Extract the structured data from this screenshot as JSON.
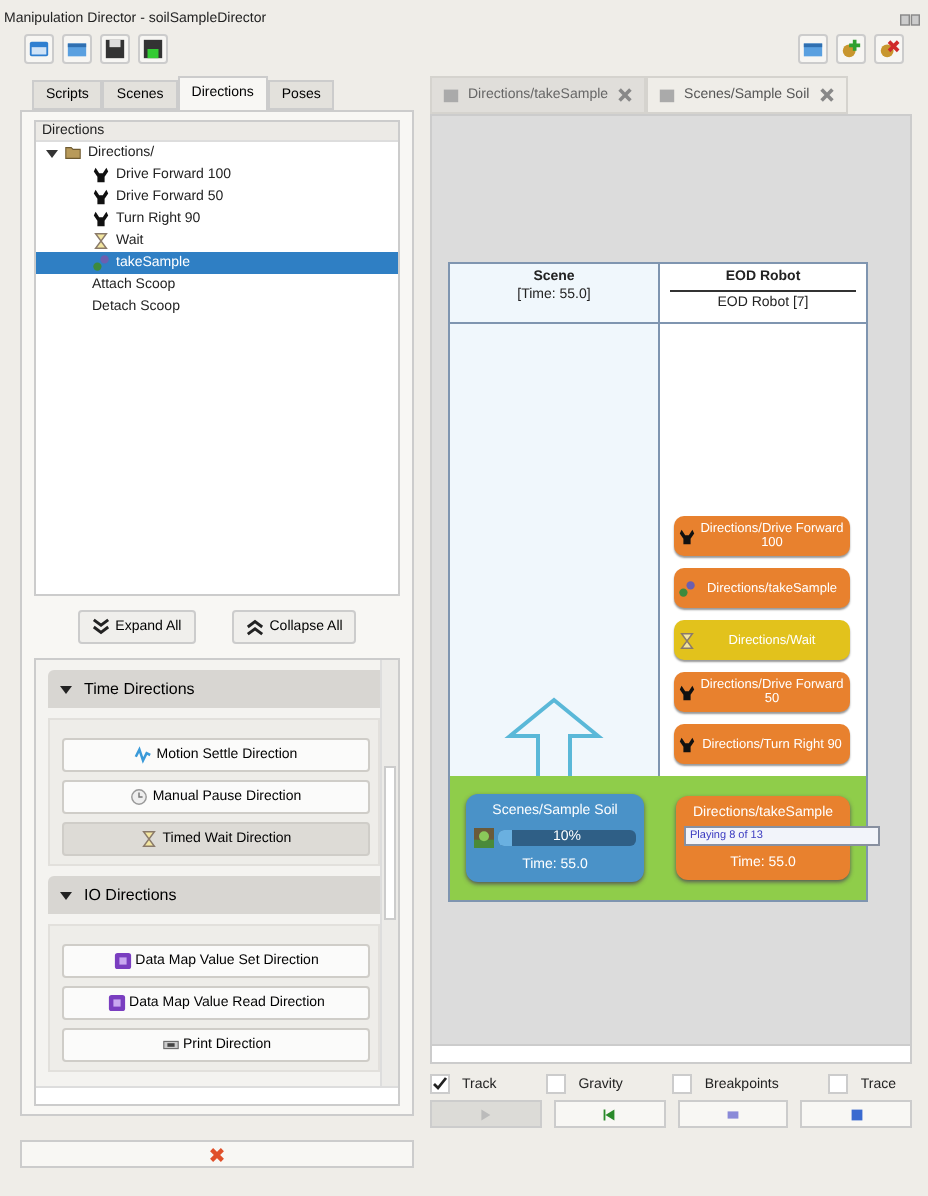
{
  "window": {
    "title": "Manipulation Director - soilSampleDirector"
  },
  "toolbar": [
    {
      "kind": "window"
    },
    {
      "kind": "panel"
    },
    {
      "kind": "save"
    },
    {
      "kind": "save-as"
    }
  ],
  "right_toolbar": [
    {
      "kind": "panel"
    },
    {
      "kind": "add"
    },
    {
      "kind": "remove"
    }
  ],
  "tabs": [
    {
      "label": "Scripts",
      "selected": false
    },
    {
      "label": "Scenes",
      "selected": false
    },
    {
      "label": "Directions",
      "selected": true
    },
    {
      "label": "Poses",
      "selected": false
    }
  ],
  "tree": {
    "header": "Directions",
    "items": [
      {
        "label": "Directions/",
        "kind": "folder",
        "selected": false,
        "expanded": true,
        "children": [
          {
            "label": "Drive Forward 100",
            "kind": "robot",
            "selected": false
          },
          {
            "label": "Drive Forward 50",
            "kind": "robot",
            "selected": false
          },
          {
            "label": "Turn Right 90",
            "kind": "robot",
            "selected": false
          },
          {
            "label": "Wait",
            "kind": "hourglass",
            "selected": false
          },
          {
            "label": "takeSample",
            "kind": "sample",
            "selected": true
          }
        ]
      },
      {
        "label": "Attach Scoop",
        "kind": "none",
        "selected": false
      },
      {
        "label": "Detach Scoop",
        "kind": "none",
        "selected": false
      }
    ]
  },
  "tree_buttons": [
    {
      "label": "Expand All",
      "kind": "expand"
    },
    {
      "label": "Collapse All",
      "kind": "collapse"
    }
  ],
  "groups": [
    {
      "title": "Time Directions",
      "expanded": true,
      "buttons": [
        {
          "label": "Motion Settle Direction",
          "kind": "motion",
          "selected": false
        },
        {
          "label": "Manual Pause Direction",
          "kind": "clock",
          "selected": false
        },
        {
          "label": "Timed Wait Direction",
          "kind": "hourglass",
          "selected": true
        }
      ]
    },
    {
      "title": "IO Directions",
      "expanded": true,
      "buttons": [
        {
          "label": "Data Map Value Set Direction",
          "kind": "data",
          "selected": false
        },
        {
          "label": "Data Map Value Read Direction",
          "kind": "data",
          "selected": false
        },
        {
          "label": "Print Direction",
          "kind": "print",
          "selected": false
        }
      ]
    }
  ],
  "doc_tabs": [
    {
      "label": "Directions/takeSample",
      "selected": false
    },
    {
      "label": "Scenes/Sample Soil",
      "selected": true
    }
  ],
  "diagram": {
    "scene_header": "Scene",
    "scene_time": "[Time: 55.0]",
    "robot_header": "EOD Robot",
    "robot_sub": "EOD Robot [7]",
    "robot_blocks": [
      {
        "label": "Directions/Drive Forward 100",
        "kind": "robot",
        "color": "#e8812e"
      },
      {
        "label": "Directions/takeSample",
        "kind": "sample",
        "color": "#e8812e"
      },
      {
        "label": "Directions/Wait",
        "kind": "hourglass",
        "color": "#e2c21c"
      },
      {
        "label": "Directions/Drive Forward 50",
        "kind": "robot",
        "color": "#e8812e"
      },
      {
        "label": "Directions/Turn Right 90",
        "kind": "robot",
        "color": "#e8812e"
      }
    ],
    "scene_active": {
      "label": "Scenes/Sample Soil",
      "level": 0.1,
      "reading": "10%",
      "time": "Time: 55.0"
    },
    "robot_active": {
      "label": "Directions/takeSample",
      "tooltip": "Playing 8 of 13",
      "time": "Time: 55.0"
    }
  },
  "options": [
    {
      "label": "Track",
      "checked": true
    },
    {
      "label": "Gravity",
      "checked": false
    },
    {
      "label": "Breakpoints",
      "checked": false
    },
    {
      "label": "Trace",
      "checked": false
    }
  ],
  "transport": [
    {
      "kind": "play",
      "disabled": true
    },
    {
      "kind": "step",
      "disabled": false
    },
    {
      "kind": "pause",
      "disabled": false
    },
    {
      "kind": "stop",
      "disabled": false
    }
  ]
}
